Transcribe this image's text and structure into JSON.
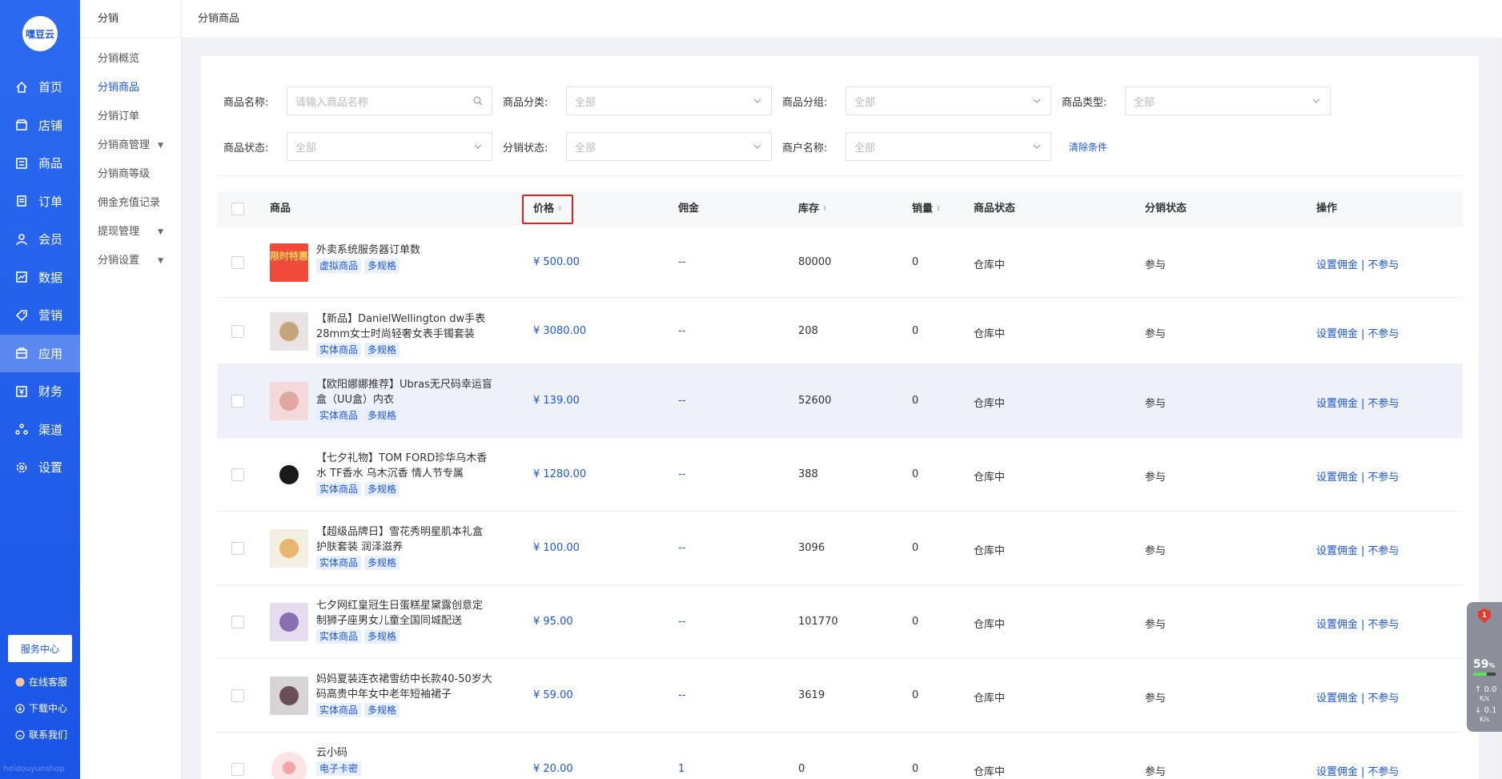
{
  "brand": {
    "logo_text": "嘿豆云",
    "watermark": "heidouyunshop"
  },
  "sidebar": {
    "items": [
      {
        "label": "首页",
        "icon": "home-icon"
      },
      {
        "label": "店铺",
        "icon": "shop-icon"
      },
      {
        "label": "商品",
        "icon": "goods-icon"
      },
      {
        "label": "订单",
        "icon": "order-icon"
      },
      {
        "label": "会员",
        "icon": "member-icon"
      },
      {
        "label": "数据",
        "icon": "chart-icon"
      },
      {
        "label": "营销",
        "icon": "tag-icon"
      },
      {
        "label": "应用",
        "icon": "app-icon",
        "active": true
      },
      {
        "label": "财务",
        "icon": "finance-icon"
      },
      {
        "label": "渠道",
        "icon": "channel-icon"
      },
      {
        "label": "设置",
        "icon": "gear-icon"
      }
    ],
    "service_center": "服务中心",
    "links": [
      "在线客服",
      "下载中心",
      "联系我们"
    ]
  },
  "submenu": {
    "title": "分销",
    "items": [
      {
        "label": "分销概览"
      },
      {
        "label": "分销商品",
        "active": true
      },
      {
        "label": "分销订单"
      },
      {
        "label": "分销商管理",
        "caret": true
      },
      {
        "label": "分销商等级"
      },
      {
        "label": "佣金充值记录"
      },
      {
        "label": "提现管理",
        "caret": true
      },
      {
        "label": "分销设置",
        "caret": true
      }
    ]
  },
  "topbar": {
    "title": "分销商品"
  },
  "filters": {
    "product_name": {
      "label": "商品名称:",
      "placeholder": "请输入商品名称"
    },
    "category": {
      "label": "商品分类:",
      "value": "全部"
    },
    "group": {
      "label": "商品分组:",
      "value": "全部"
    },
    "type": {
      "label": "商品类型:",
      "value": "全部"
    },
    "status": {
      "label": "商品状态:",
      "value": "全部"
    },
    "dist_status": {
      "label": "分销状态:",
      "value": "全部"
    },
    "merchant": {
      "label": "商户名称:",
      "value": "全部"
    },
    "clear": "清除条件"
  },
  "table": {
    "headers": {
      "product": "商品",
      "price": "价格",
      "commission": "佣金",
      "stock": "库存",
      "sales": "销量",
      "goods_status": "商品状态",
      "dist_status": "分销状态",
      "actions": "操作"
    },
    "rows": [
      {
        "name": "外卖系统服务器订单数",
        "tags": [
          "虚拟商品",
          "多规格"
        ],
        "price": "¥ 500.00",
        "commission": "--",
        "stock": "80000",
        "sales": "0",
        "goods_status": "仓库中",
        "dist_status": "参与",
        "thumb_text": "限时特惠"
      },
      {
        "name": "【新品】DanielWellington dw手表28mm女士时尚轻奢女表手镯套装",
        "tags": [
          "实体商品",
          "多规格"
        ],
        "price": "¥ 3080.00",
        "commission": "--",
        "stock": "208",
        "sales": "0",
        "goods_status": "仓库中",
        "dist_status": "参与"
      },
      {
        "name": "【欧阳娜娜推荐】Ubras无尺码幸运盲盒（UU盒）内衣",
        "tags": [
          "实体商品",
          "多规格"
        ],
        "price": "¥ 139.00",
        "commission": "--",
        "stock": "52600",
        "sales": "0",
        "goods_status": "仓库中",
        "dist_status": "参与"
      },
      {
        "name": "【七夕礼物】TOM FORD珍华乌木香水 TF香水 乌木沉香 情人节专属",
        "tags": [
          "实体商品",
          "多规格"
        ],
        "price": "¥ 1280.00",
        "commission": "--",
        "stock": "388",
        "sales": "0",
        "goods_status": "仓库中",
        "dist_status": "参与"
      },
      {
        "name": "【超级品牌日】雪花秀明星肌本礼盒护肤套装 润泽滋养",
        "tags": [
          "实体商品",
          "多规格"
        ],
        "price": "¥ 100.00",
        "commission": "--",
        "stock": "3096",
        "sales": "0",
        "goods_status": "仓库中",
        "dist_status": "参与"
      },
      {
        "name": "七夕网红皇冠生日蛋糕星黛露创意定制狮子座男女儿童全国同城配送",
        "tags": [
          "实体商品",
          "多规格"
        ],
        "price": "¥ 95.00",
        "commission": "--",
        "stock": "101770",
        "sales": "0",
        "goods_status": "仓库中",
        "dist_status": "参与"
      },
      {
        "name": "妈妈夏装连衣裙雪纺中长款40-50岁大码高贵中年女中老年短袖裙子",
        "tags": [
          "实体商品",
          "多规格"
        ],
        "price": "¥ 59.00",
        "commission": "--",
        "stock": "3619",
        "sales": "0",
        "goods_status": "仓库中",
        "dist_status": "参与"
      },
      {
        "name": "云小码",
        "tags": [
          "电子卡密"
        ],
        "price": "¥ 20.00",
        "commission": "1",
        "stock": "0",
        "sales": "0",
        "goods_status": "仓库中",
        "dist_status": "参与"
      }
    ],
    "action_set": "设置佣金",
    "action_sep": "|",
    "action_no": "不参与"
  },
  "widget": {
    "percent": "59",
    "percent_unit": "%",
    "up": "0.0",
    "down": "0.1",
    "unit": "K/s",
    "badge": "1"
  },
  "colors": {
    "brand": "#1a55e6",
    "highlight": "#e0201e"
  }
}
